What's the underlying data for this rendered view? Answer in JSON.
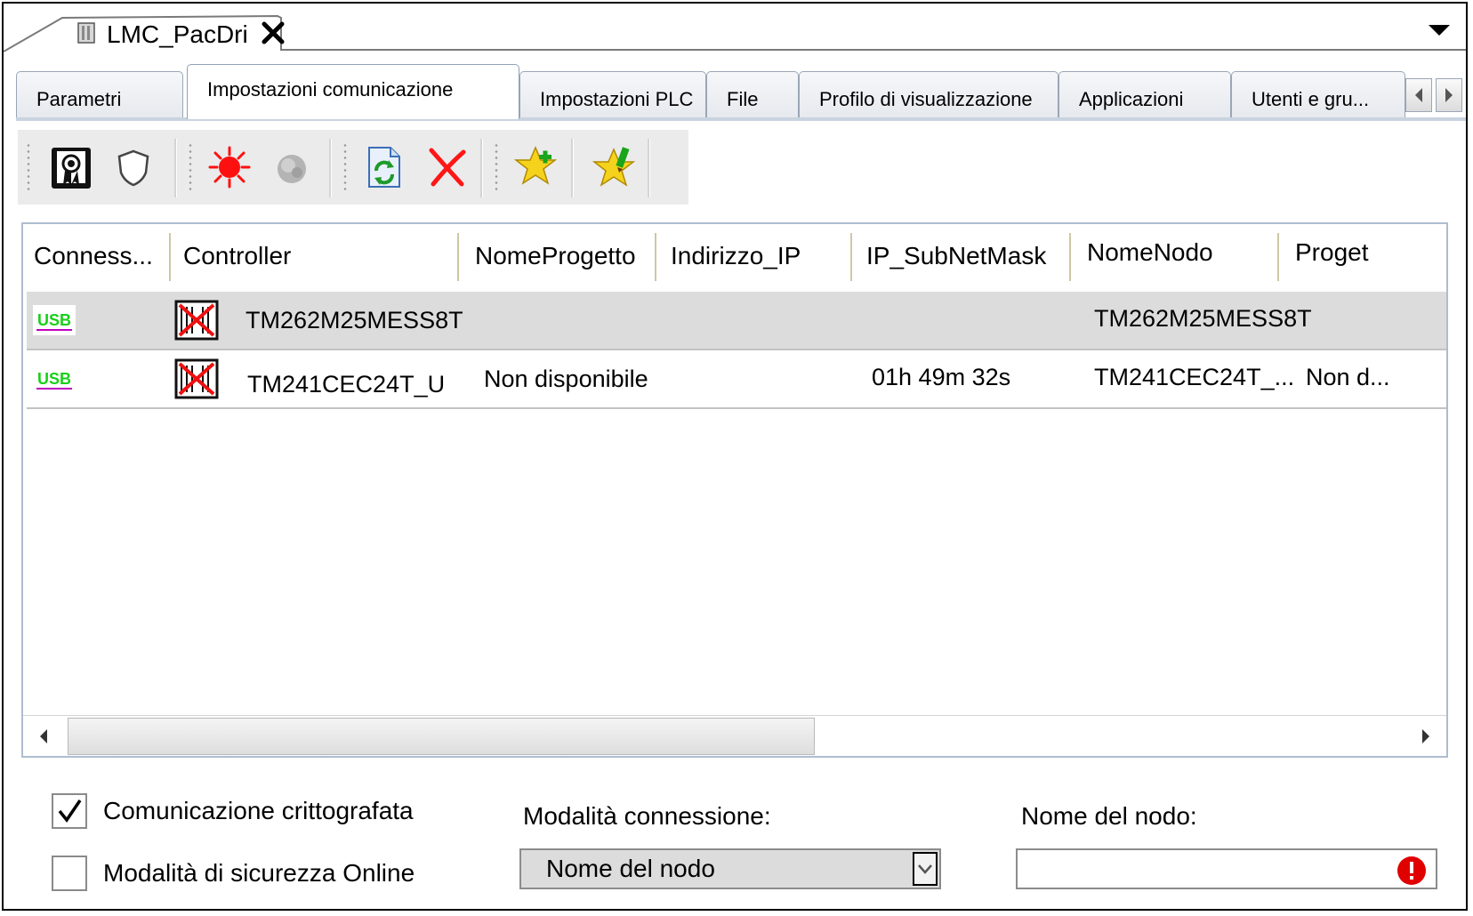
{
  "document": {
    "title": "LMC_PacDri"
  },
  "tabs": [
    {
      "label": "Parametri"
    },
    {
      "label": "Impostazioni comunicazione"
    },
    {
      "label": "Impostazioni PLC"
    },
    {
      "label": "File"
    },
    {
      "label": "Profilo di visualizzazione"
    },
    {
      "label": "Applicazioni"
    },
    {
      "label": "Utenti e gru..."
    }
  ],
  "active_tab": "Impostazioni comunicazione",
  "toolbar": {
    "icons": [
      "certificate-icon",
      "shield-icon",
      "red-burst-icon",
      "gray-burst-icon",
      "refresh-icon",
      "delete-icon",
      "star-add-icon",
      "star-edit-icon"
    ]
  },
  "grid": {
    "columns": [
      "Conness...",
      "Controller",
      "NomeProgetto",
      "Indirizzo_IP",
      "IP_SubNetMask",
      "NomeNodo",
      "Proget"
    ],
    "rows": [
      {
        "connection": "USB",
        "controller": "TM262M25MESS8T",
        "project": "",
        "ip": "",
        "subnet": "",
        "node": "TM262M25MESS8T",
        "project2": ""
      },
      {
        "connection": "USB",
        "controller": "TM241CEC24T_U",
        "project": "Non disponibile",
        "ip": "",
        "subnet": "01h 49m 32s",
        "node": "TM241CEC24T_...",
        "project2": "Non d..."
      }
    ]
  },
  "options": {
    "encrypted_label": "Comunicazione crittografata",
    "encrypted_checked": true,
    "secure_online_label": "Modalità di sicurezza Online",
    "secure_online_checked": false
  },
  "connection_mode": {
    "label": "Modalità connessione:",
    "value": "Nome del nodo"
  },
  "node_name": {
    "label": "Nome del nodo:",
    "value": ""
  },
  "colors": {
    "usb_green": "#18d018",
    "usb_underline": "#c000c0",
    "error_red": "#e00000",
    "selected_row": "#dcdcdc"
  }
}
